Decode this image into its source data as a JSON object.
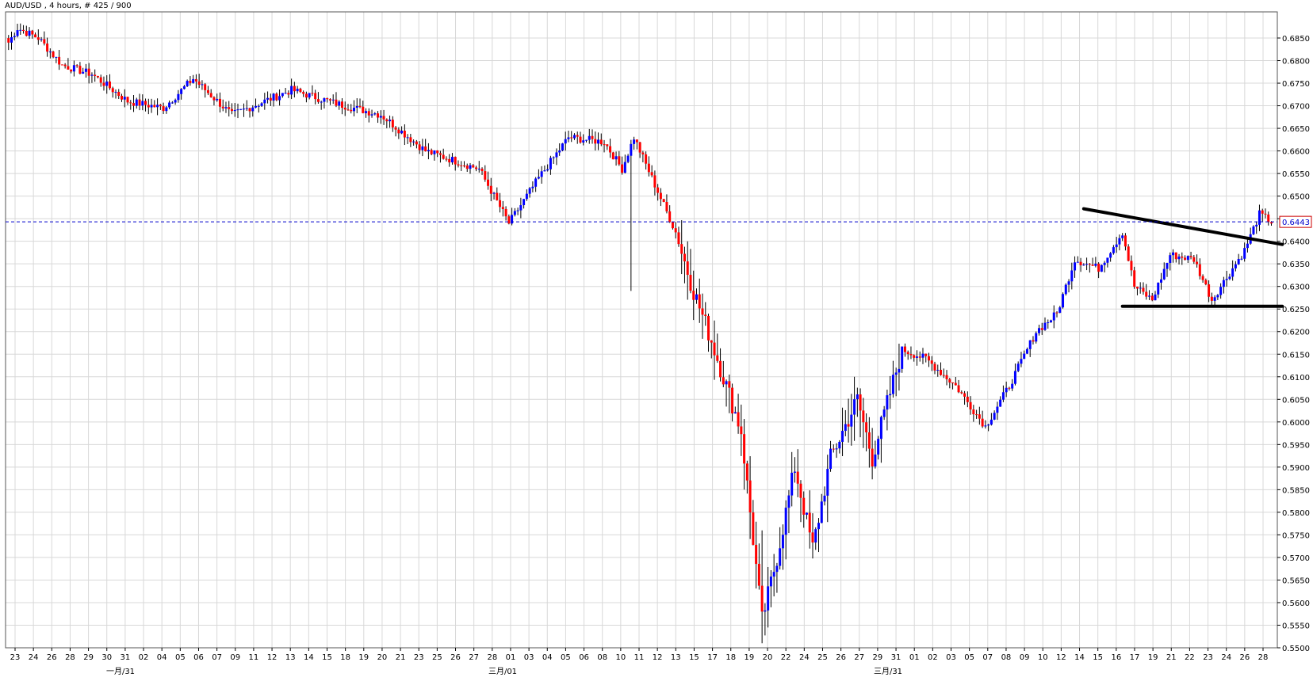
{
  "chart_data": {
    "type": "candlestick",
    "title": "AUD/USD , 4 hours, # 425 / 900",
    "ylim": [
      0.55,
      0.688
    ],
    "y_ticks": [
      "0.6850",
      "0.6800",
      "0.6750",
      "0.6700",
      "0.6650",
      "0.6600",
      "0.6550",
      "0.6500",
      "0.6450",
      "0.6400",
      "0.6350",
      "0.6300",
      "0.6250",
      "0.6200",
      "0.6150",
      "0.6100",
      "0.6050",
      "0.6000",
      "0.5950",
      "0.5900",
      "0.5850",
      "0.5800",
      "0.5750",
      "0.5700",
      "0.5650",
      "0.5600",
      "0.5550",
      "0.5500"
    ],
    "x_ticks": [
      "23",
      "24",
      "26",
      "28",
      "29",
      "30",
      "31",
      "02",
      "04",
      "05",
      "06",
      "07",
      "09",
      "11",
      "12",
      "13",
      "14",
      "15",
      "18",
      "19",
      "20",
      "21",
      "23",
      "25",
      "26",
      "27",
      "28",
      "01",
      "03",
      "04",
      "05",
      "06",
      "08",
      "10",
      "11",
      "12",
      "13",
      "15",
      "17",
      "18",
      "19",
      "20",
      "22",
      "24",
      "25",
      "26",
      "27",
      "29",
      "31",
      "01",
      "02",
      "03",
      "05",
      "07",
      "08",
      "09",
      "10",
      "12",
      "14",
      "15",
      "16",
      "17",
      "19",
      "21",
      "22",
      "23",
      "24",
      "26",
      "28"
    ],
    "x_month_labels": [
      "一月/31",
      "三月/01",
      "三月/31"
    ],
    "current_price": "0.6443",
    "current_price_value": 0.6443,
    "grid": true,
    "up_color": "#0000ff",
    "down_color": "#ff0000",
    "candle_count": 425,
    "key_points": [
      {
        "bar": 0,
        "price": 0.684
      },
      {
        "bar": 3,
        "price": 0.6872
      },
      {
        "bar": 10,
        "price": 0.685
      },
      {
        "bar": 18,
        "price": 0.679
      },
      {
        "bar": 28,
        "price": 0.677
      },
      {
        "bar": 40,
        "price": 0.671
      },
      {
        "bar": 52,
        "price": 0.6695
      },
      {
        "bar": 62,
        "price": 0.676
      },
      {
        "bar": 75,
        "price": 0.668
      },
      {
        "bar": 95,
        "price": 0.6735
      },
      {
        "bar": 110,
        "price": 0.6705
      },
      {
        "bar": 125,
        "price": 0.668
      },
      {
        "bar": 140,
        "price": 0.66
      },
      {
        "bar": 158,
        "price": 0.656
      },
      {
        "bar": 168,
        "price": 0.644
      },
      {
        "bar": 178,
        "price": 0.654
      },
      {
        "bar": 188,
        "price": 0.663
      },
      {
        "bar": 200,
        "price": 0.662
      },
      {
        "bar": 206,
        "price": 0.656
      },
      {
        "bar": 210,
        "price": 0.663
      },
      {
        "bar": 220,
        "price": 0.648
      },
      {
        "bar": 224,
        "price": 0.642
      },
      {
        "bar": 230,
        "price": 0.629
      },
      {
        "bar": 236,
        "price": 0.618
      },
      {
        "bar": 246,
        "price": 0.598
      },
      {
        "bar": 253,
        "price": 0.556
      },
      {
        "bar": 258,
        "price": 0.57
      },
      {
        "bar": 264,
        "price": 0.59
      },
      {
        "bar": 270,
        "price": 0.572
      },
      {
        "bar": 276,
        "price": 0.592
      },
      {
        "bar": 285,
        "price": 0.605
      },
      {
        "bar": 290,
        "price": 0.592
      },
      {
        "bar": 300,
        "price": 0.616
      },
      {
        "bar": 308,
        "price": 0.614
      },
      {
        "bar": 318,
        "price": 0.608
      },
      {
        "bar": 328,
        "price": 0.599
      },
      {
        "bar": 336,
        "price": 0.608
      },
      {
        "bar": 345,
        "price": 0.62
      },
      {
        "bar": 352,
        "price": 0.624
      },
      {
        "bar": 358,
        "price": 0.636
      },
      {
        "bar": 366,
        "price": 0.634
      },
      {
        "bar": 374,
        "price": 0.642
      },
      {
        "bar": 378,
        "price": 0.63
      },
      {
        "bar": 384,
        "price": 0.627
      },
      {
        "bar": 390,
        "price": 0.637
      },
      {
        "bar": 398,
        "price": 0.636
      },
      {
        "bar": 404,
        "price": 0.627
      },
      {
        "bar": 410,
        "price": 0.633
      },
      {
        "bar": 415,
        "price": 0.638
      },
      {
        "bar": 420,
        "price": 0.646
      },
      {
        "bar": 424,
        "price": 0.6443
      }
    ],
    "trendlines": [
      {
        "x1_bar": 361,
        "y1": 0.6472,
        "x2_bar": 425,
        "y2": 0.6393,
        "width": 4
      },
      {
        "x1_bar": 374,
        "y1": 0.6256,
        "x2_bar": 425,
        "y2": 0.6256,
        "width": 4
      }
    ]
  }
}
